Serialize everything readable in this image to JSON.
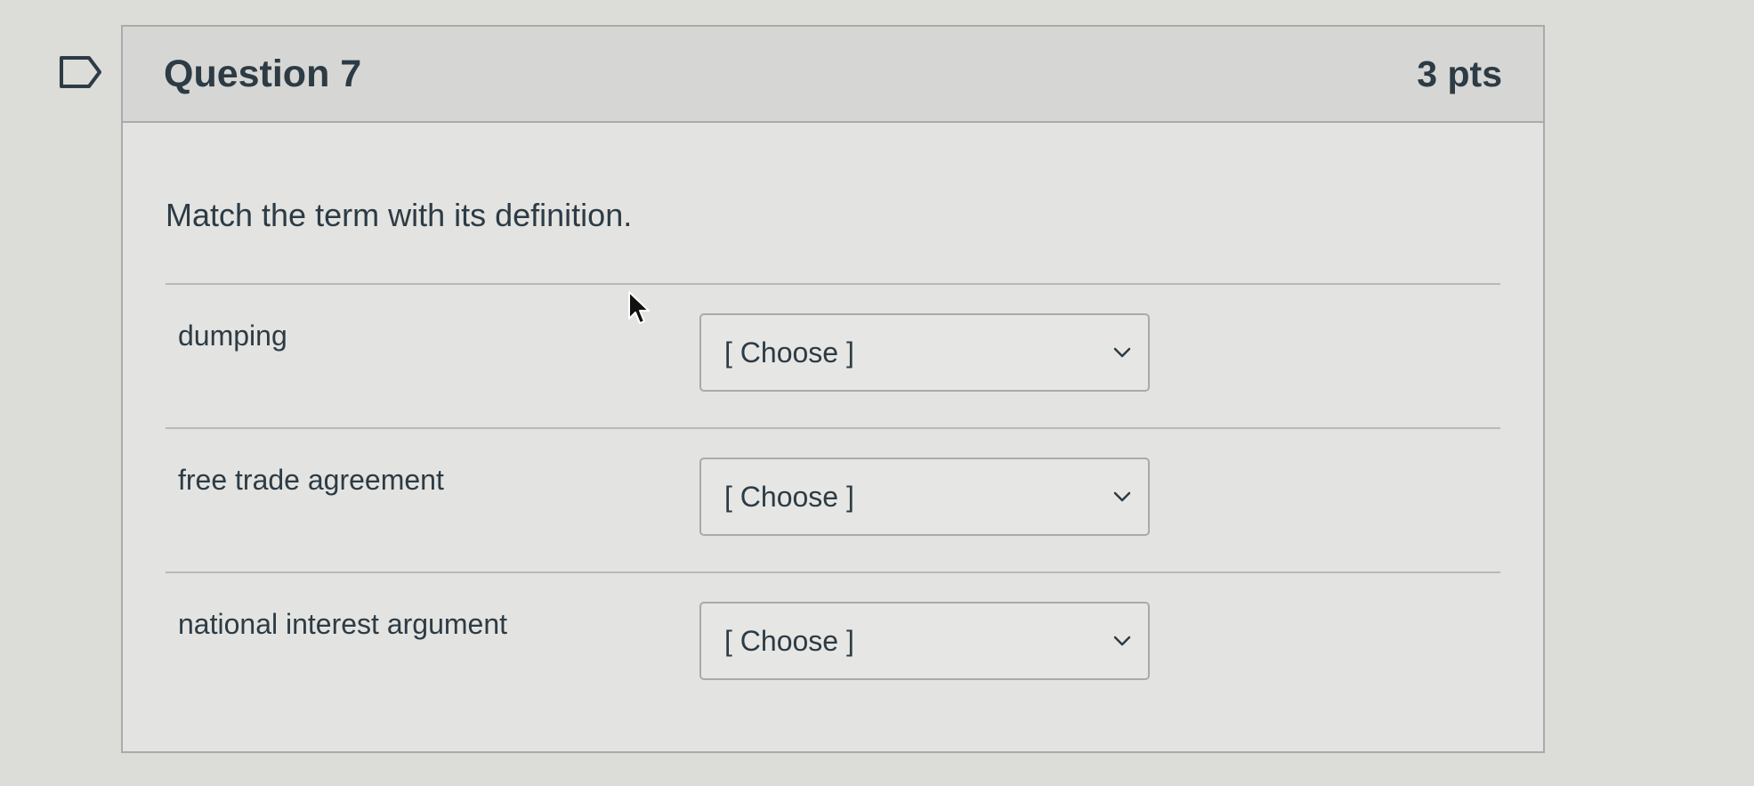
{
  "question": {
    "title": "Question 7",
    "points": "3 pts",
    "prompt": "Match the term with its definition."
  },
  "matches": [
    {
      "term": "dumping",
      "selected": "[ Choose ]"
    },
    {
      "term": "free trade agreement",
      "selected": "[ Choose ]"
    },
    {
      "term": "national interest argument",
      "selected": "[ Choose ]"
    }
  ],
  "icons": {
    "flag": "flag-question-icon",
    "dropdown": "chevron-down-icon",
    "pointer": "mouse-cursor-icon"
  },
  "colors": {
    "background": "#dcdcd8",
    "header": "#d6d7d4",
    "text": "#2d3b45",
    "border": "#a9abaa"
  }
}
